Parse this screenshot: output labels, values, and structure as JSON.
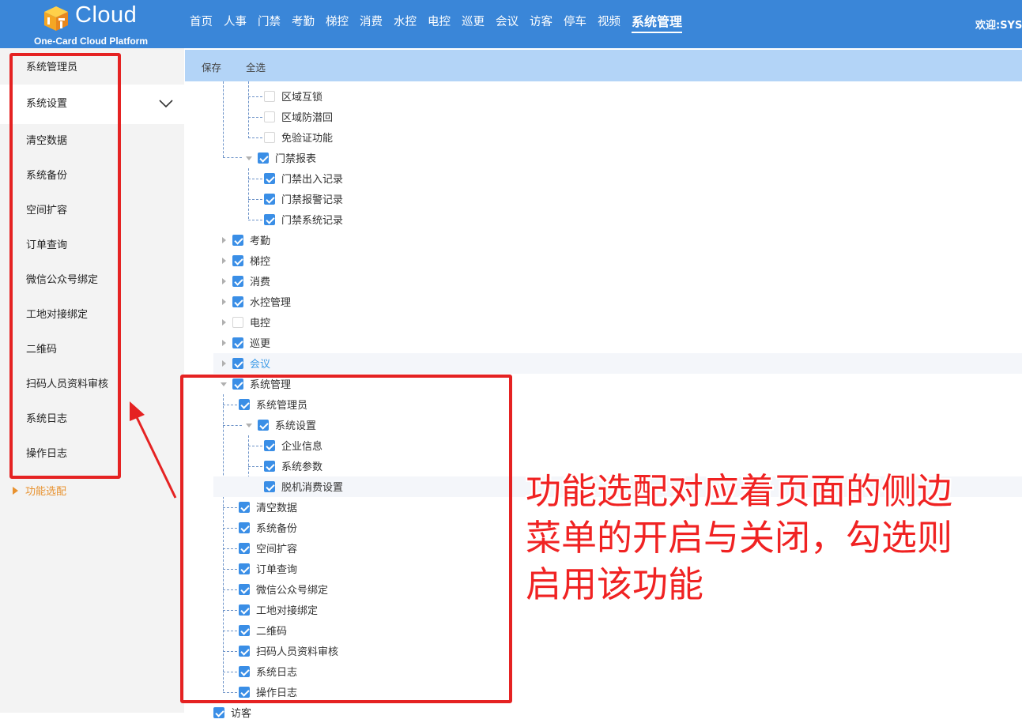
{
  "header": {
    "logo_text": "Cloud",
    "logo_sub": "One-Card Cloud Platform",
    "logo_icon": "box-logo-icon",
    "nav": [
      "首页",
      "人事",
      "门禁",
      "考勤",
      "梯控",
      "消费",
      "水控",
      "电控",
      "巡更",
      "会议",
      "访客",
      "停车",
      "视频",
      "系统管理"
    ],
    "active_nav": "系统管理",
    "welcome": "欢迎:SYS"
  },
  "sidebar": {
    "items": [
      "系统管理员",
      "系统设置",
      "清空数据",
      "系统备份",
      "空间扩容",
      "订单查询",
      "微信公众号绑定",
      "工地对接绑定",
      "二维码",
      "扫码人员资料审核",
      "系统日志",
      "操作日志"
    ],
    "open_item": "系统设置",
    "function_item": "功能选配"
  },
  "toolbar": {
    "save": "保存",
    "select_all": "全选"
  },
  "tree": {
    "rows": [
      {
        "label": "区域互锁",
        "checked": false
      },
      {
        "label": "区域防潜回",
        "checked": false
      },
      {
        "label": "免验证功能",
        "checked": false
      },
      {
        "label": "门禁报表",
        "checked": true
      },
      {
        "label": "门禁出入记录",
        "checked": true
      },
      {
        "label": "门禁报警记录",
        "checked": true
      },
      {
        "label": "门禁系统记录",
        "checked": true
      },
      {
        "label": "考勤",
        "checked": true
      },
      {
        "label": "梯控",
        "checked": true
      },
      {
        "label": "消费",
        "checked": true
      },
      {
        "label": "水控管理",
        "checked": true
      },
      {
        "label": "电控",
        "checked": false
      },
      {
        "label": "巡更",
        "checked": true
      },
      {
        "label": "会议",
        "checked": true
      },
      {
        "label": "系统管理",
        "checked": true
      },
      {
        "label": "系统管理员",
        "checked": true
      },
      {
        "label": "系统设置",
        "checked": true
      },
      {
        "label": "企业信息",
        "checked": true
      },
      {
        "label": "系统参数",
        "checked": true
      },
      {
        "label": "脱机消费设置",
        "checked": true
      },
      {
        "label": "清空数据",
        "checked": true
      },
      {
        "label": "系统备份",
        "checked": true
      },
      {
        "label": "空间扩容",
        "checked": true
      },
      {
        "label": "订单查询",
        "checked": true
      },
      {
        "label": "微信公众号绑定",
        "checked": true
      },
      {
        "label": "工地对接绑定",
        "checked": true
      },
      {
        "label": "二维码",
        "checked": true
      },
      {
        "label": "扫码人员资料审核",
        "checked": true
      },
      {
        "label": "系统日志",
        "checked": true
      },
      {
        "label": "操作日志",
        "checked": true
      },
      {
        "label": "访客",
        "checked": true
      }
    ]
  },
  "annotation": {
    "lines": [
      "功能选配对应着页面的侧边",
      "菜单的开启与关闭，勾选则",
      "启用该功能"
    ],
    "color": "#e52222"
  }
}
